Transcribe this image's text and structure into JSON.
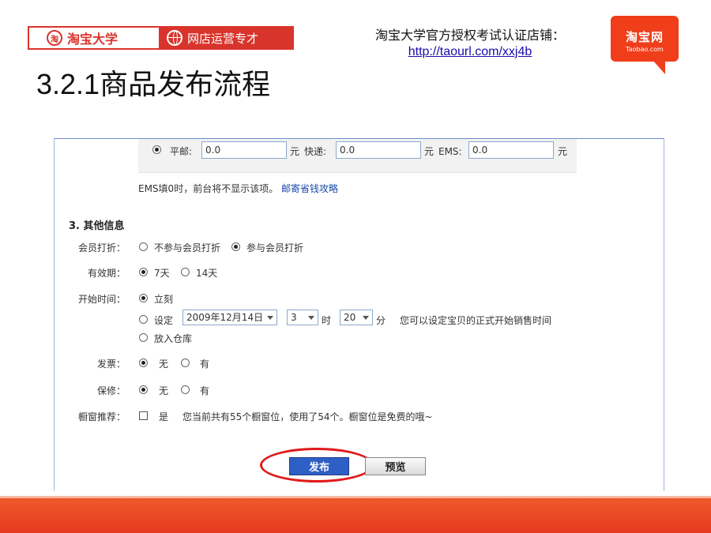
{
  "header": {
    "brand_name": "淘宝大学",
    "brand_slogan": "网店运营专才",
    "seal_glyph": "淘",
    "store_line": "淘宝大学官方授权考试认证店铺：",
    "store_link": "http://taourl.com/xxj4b",
    "logo_zh": "淘宝网",
    "logo_en": "Taobao.com"
  },
  "slide_title": "3.2.1商品发布流程",
  "shipping": {
    "post_label": "平邮:",
    "post_value": "0.0",
    "unit": "元",
    "express_label": "快递:",
    "express_value": "0.0",
    "ems_label": "EMS:",
    "ems_value": "0.0",
    "note": "EMS填0时，前台将不显示该项。",
    "note_link": "邮寄省钱攻略"
  },
  "other_info": {
    "title": "3. 其他信息",
    "member_discount": {
      "label": "会员打折：",
      "opt_no": "不参与会员打折",
      "opt_yes": "参与会员打折"
    },
    "validity": {
      "label": "有效期：",
      "opt_7": "7天",
      "opt_14": "14天"
    },
    "start_time": {
      "label": "开始时间：",
      "opt_now": "立刻",
      "opt_set": "设定",
      "date_value": "2009年12月14日",
      "hour_value": "3",
      "hour_unit": "时",
      "minute_value": "20",
      "minute_unit": "分",
      "hint": "您可以设定宝贝的正式开始销售时间",
      "opt_warehouse": "放入仓库"
    },
    "invoice": {
      "label": "发票：",
      "opt_no": "无",
      "opt_yes": "有"
    },
    "warranty": {
      "label": "保修：",
      "opt_no": "无",
      "opt_yes": "有"
    },
    "window": {
      "label": "橱窗推荐：",
      "opt_yes": "是",
      "hint": "您当前共有55个橱窗位，使用了54个。橱窗位是免费的哦~"
    }
  },
  "actions": {
    "publish": "发布",
    "preview": "预览"
  },
  "colors": {
    "brand_red": "#d9342b",
    "publish_blue": "#2e5fc4",
    "highlight_red": "#e01a1a",
    "footer_orange": "#ef5a2a"
  }
}
